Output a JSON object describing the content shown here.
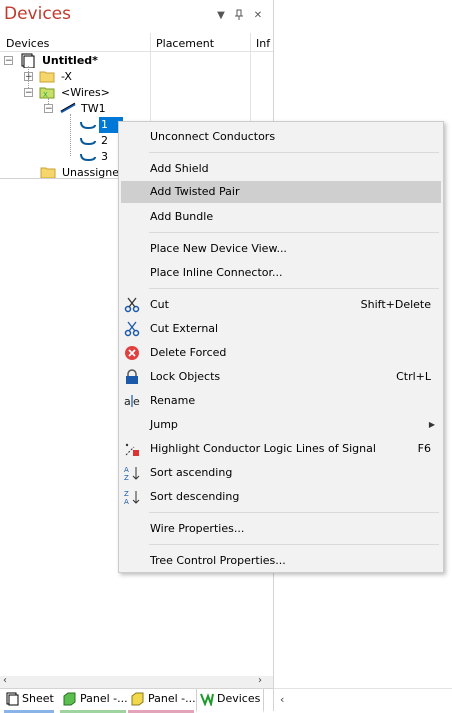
{
  "panel": {
    "title": "Devices",
    "columns": [
      "Devices",
      "Placement",
      "Inf"
    ],
    "tree": {
      "root": "Untitled*",
      "x_node": "-X",
      "wires_node": "<Wires>",
      "tw1": "TW1",
      "conductors": [
        "1",
        "2",
        "3"
      ],
      "unassigned": "Unassigned"
    }
  },
  "context_menu": {
    "items": [
      {
        "label": "Unconnect Conductors",
        "shortcut": "",
        "icon": ""
      },
      {
        "label": "Add Shield",
        "shortcut": "",
        "icon": ""
      },
      {
        "label": "Add Twisted Pair",
        "shortcut": "",
        "icon": "",
        "highlighted": true
      },
      {
        "label": "Add Bundle",
        "shortcut": "",
        "icon": ""
      },
      {
        "label": "Place New Device View...",
        "shortcut": "",
        "icon": ""
      },
      {
        "label": "Place Inline Connector...",
        "shortcut": "",
        "icon": ""
      },
      {
        "label": "Cut",
        "shortcut": "Shift+Delete",
        "icon": "scissors-icon"
      },
      {
        "label": "Cut External",
        "shortcut": "",
        "icon": "scissors-external-icon"
      },
      {
        "label": "Delete Forced",
        "shortcut": "",
        "icon": "delete-red-icon"
      },
      {
        "label": "Lock Objects",
        "shortcut": "Ctrl+L",
        "icon": "lock-icon"
      },
      {
        "label": "Rename",
        "shortcut": "",
        "icon": "rename-icon"
      },
      {
        "label": "Jump",
        "shortcut": "",
        "icon": "",
        "submenu": true
      },
      {
        "label": "Highlight Conductor Logic Lines of Signal",
        "shortcut": "F6",
        "icon": "highlight-icon"
      },
      {
        "label": "Sort ascending",
        "shortcut": "",
        "icon": "sort-asc-icon"
      },
      {
        "label": "Sort descending",
        "shortcut": "",
        "icon": "sort-desc-icon"
      },
      {
        "label": "Wire Properties...",
        "shortcut": "",
        "icon": ""
      },
      {
        "label": "Tree Control Properties...",
        "shortcut": "",
        "icon": ""
      }
    ]
  },
  "tabs": [
    "Sheet",
    "Panel -...",
    "Panel -...",
    "Devices"
  ],
  "colors": {
    "title": "#c0392b",
    "selection": "#0078d7",
    "menu_highlight": "#cfcfcf"
  }
}
